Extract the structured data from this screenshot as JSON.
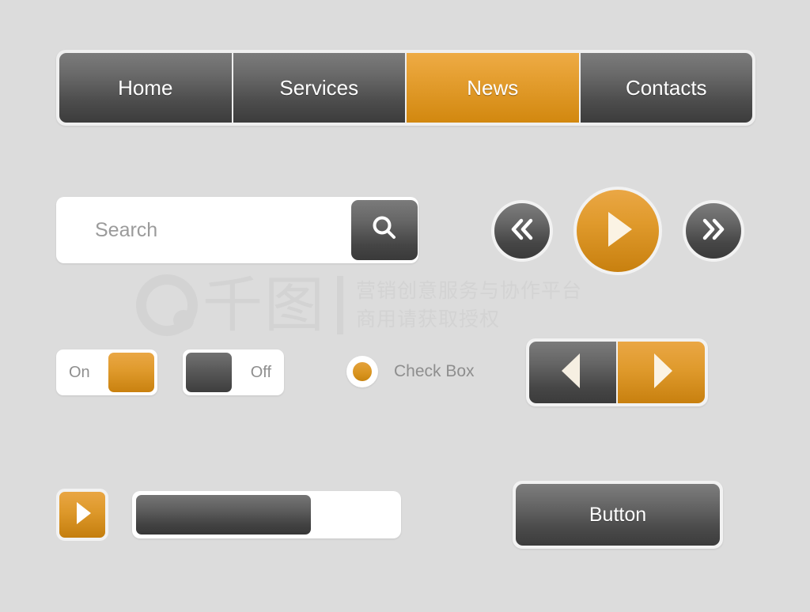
{
  "page": {
    "title": "UI Kit Elements",
    "background_color": "#dcdcdc",
    "accent_color": "#d9941f",
    "dark_color": "#4a4a4a"
  },
  "nav": {
    "items": [
      {
        "label": "Home",
        "active": false
      },
      {
        "label": "Services",
        "active": false
      },
      {
        "label": "News",
        "active": true
      },
      {
        "label": "Contacts",
        "active": false
      }
    ]
  },
  "search": {
    "value": "",
    "placeholder": "Search",
    "button_icon": "search-icon"
  },
  "media_controls": {
    "prev_icon": "double-chevron-left-icon",
    "play_icon": "play-triangle-icon",
    "next_icon": "double-chevron-right-icon"
  },
  "toggles": [
    {
      "label": "On",
      "state": "on",
      "knob_color": "#d9941f"
    },
    {
      "label": "Off",
      "state": "off",
      "knob_color": "#4a4a4a"
    }
  ],
  "checkbox": {
    "label": "Check Box",
    "checked": true,
    "dot_color": "#d9941f"
  },
  "pager": {
    "prev_icon": "triangle-left-icon",
    "next_icon": "triangle-right-icon"
  },
  "player": {
    "play_icon": "play-triangle-icon",
    "progress_percent": 67
  },
  "button": {
    "label": "Button"
  },
  "watermark": {
    "logo_text": "千图",
    "line1": "营销创意服务与协作平台",
    "line2": "商用请获取授权"
  }
}
